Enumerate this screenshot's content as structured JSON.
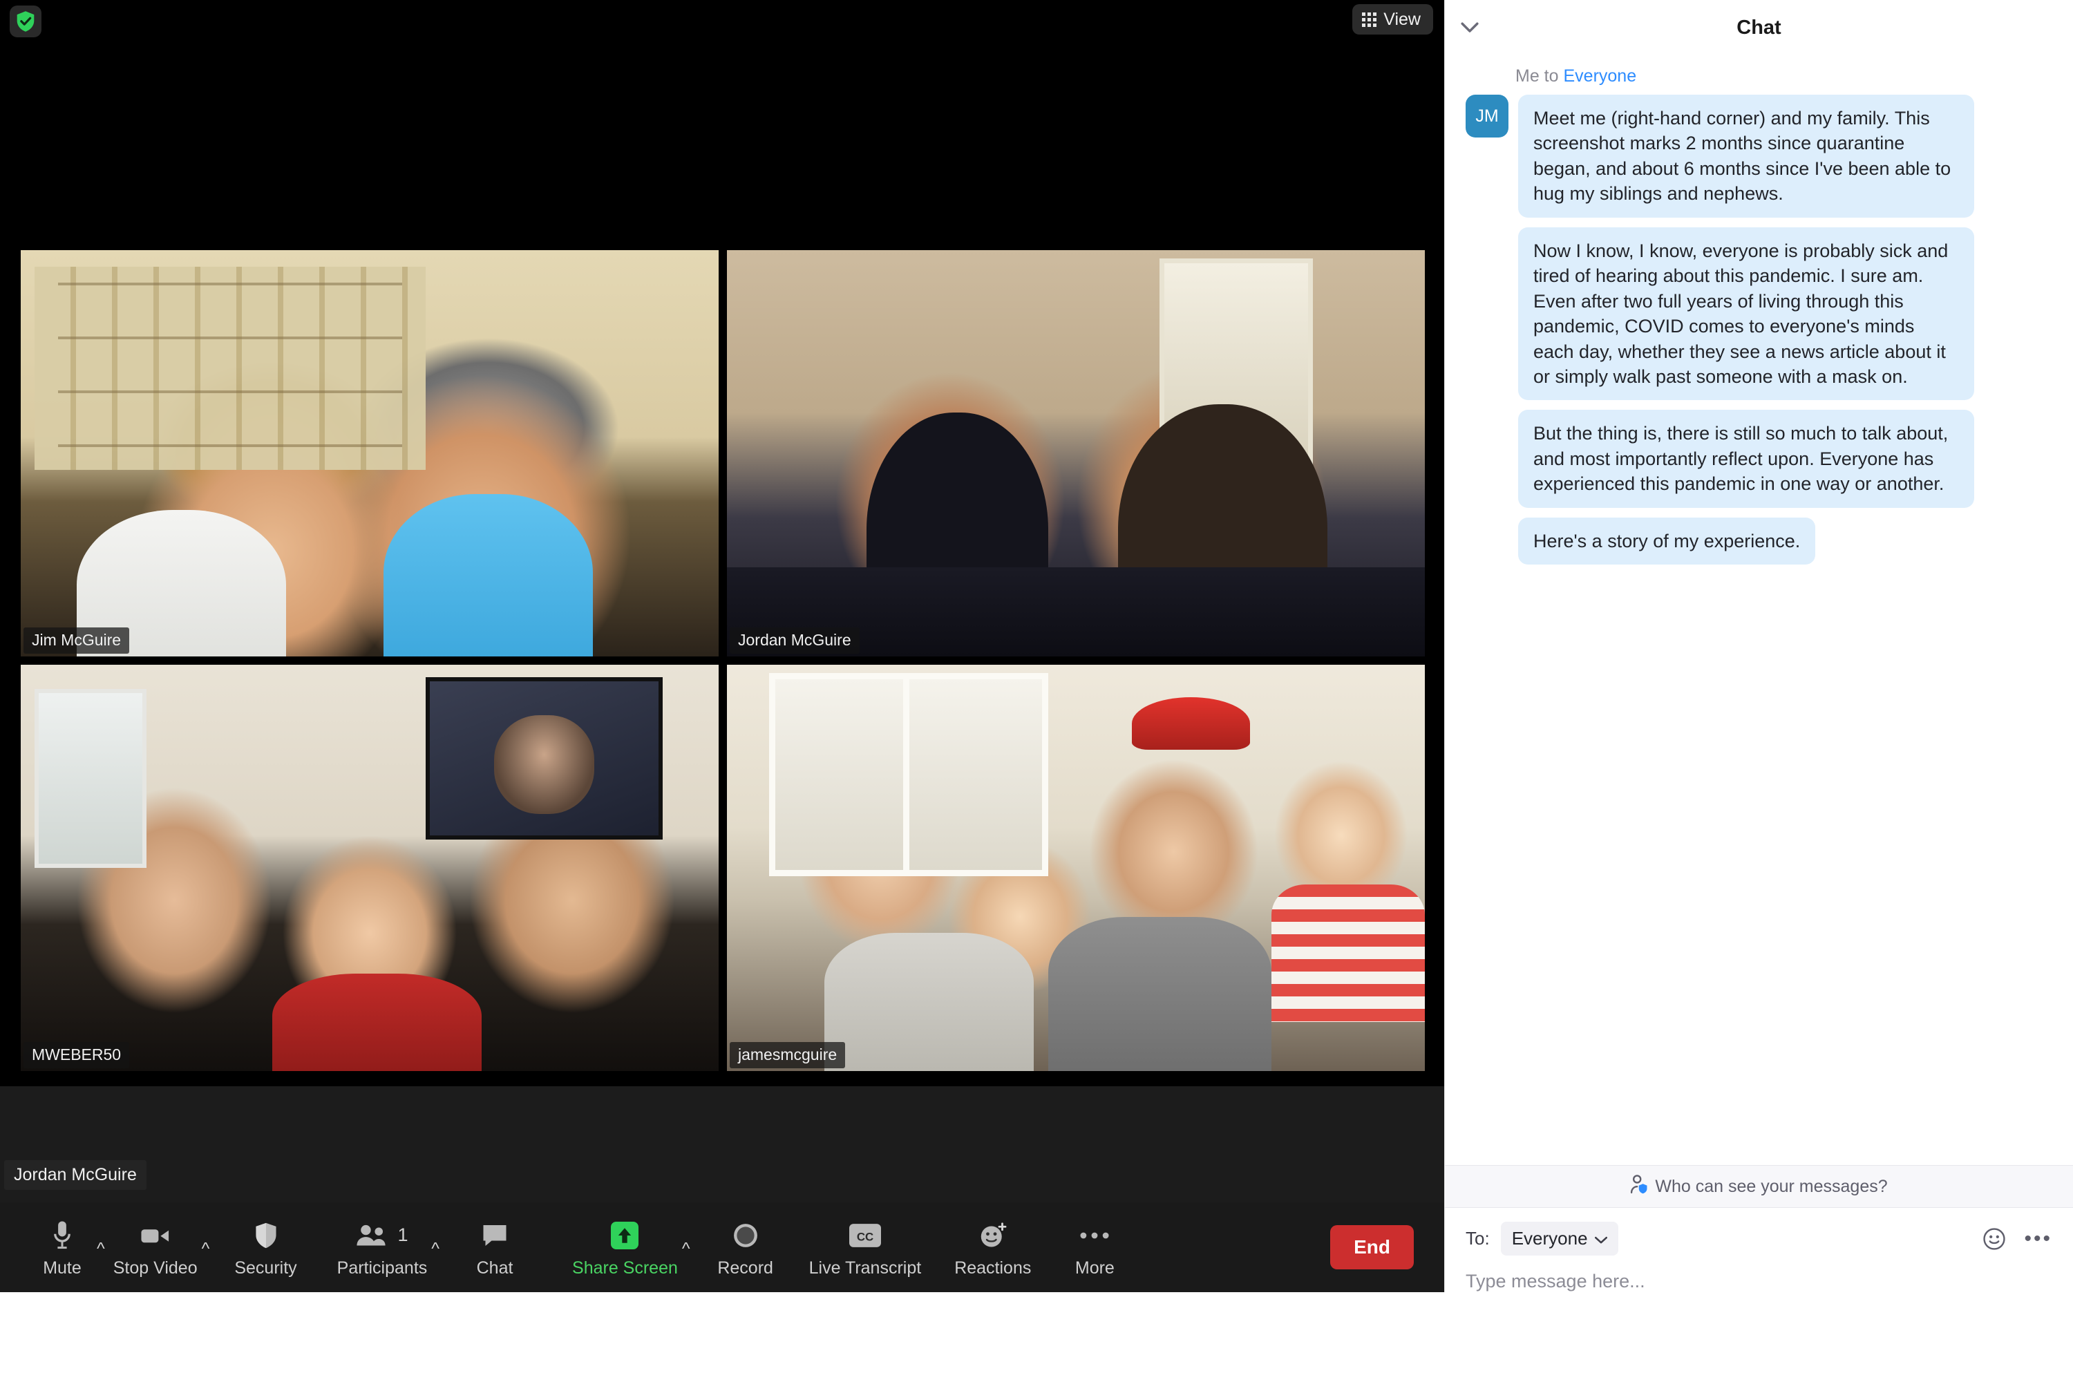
{
  "meeting": {
    "encryption_icon": "shield-check-icon",
    "view_button": {
      "label": "View",
      "icon": "grid-icon"
    },
    "self_name_label": "Jordan McGuire",
    "active_speaker_border_color": "#f2f36b",
    "participants": [
      {
        "name": "Jim McGuire",
        "active": false
      },
      {
        "name": "Jordan McGuire",
        "active": false
      },
      {
        "name": "MWEBER50",
        "active": false
      },
      {
        "name": "jamesmcguire",
        "active": true
      }
    ]
  },
  "toolbar": {
    "items": [
      {
        "label": "Mute",
        "icon": "microphone-icon",
        "caret": true,
        "accent": false
      },
      {
        "label": "Stop Video",
        "icon": "video-camera-icon",
        "caret": true,
        "accent": false
      },
      {
        "label": "Security",
        "icon": "shield-icon",
        "caret": false,
        "accent": false
      },
      {
        "label": "Participants",
        "icon": "people-icon",
        "caret": true,
        "accent": false,
        "badge": "1"
      },
      {
        "label": "Chat",
        "icon": "speech-bubble-icon",
        "caret": false,
        "accent": false
      },
      {
        "label": "Share Screen",
        "icon": "share-arrow-icon",
        "caret": true,
        "accent": true
      },
      {
        "label": "Record",
        "icon": "record-circle-icon",
        "caret": false,
        "accent": false
      },
      {
        "label": "Live Transcript",
        "icon": "cc-icon",
        "caret": false,
        "accent": false
      },
      {
        "label": "Reactions",
        "icon": "smiley-plus-icon",
        "caret": false,
        "accent": false
      },
      {
        "label": "More",
        "icon": "ellipsis-icon",
        "caret": false,
        "accent": false
      }
    ],
    "end_label": "End",
    "end_color": "#cc2e2e",
    "accent_color": "#4ad463"
  },
  "chat": {
    "title": "Chat",
    "collapse_icon": "chevron-down-icon",
    "from_prefix": "Me to ",
    "from_target": "Everyone",
    "avatar_initials": "JM",
    "avatar_color": "#2d8cc0",
    "link_color": "#2d8cff",
    "bubble_color": "#ddeefc",
    "messages": [
      "Meet me (right-hand corner) and my family. This screenshot marks 2 months since quarantine began, and about 6 months since I've been able to hug my siblings and nephews.",
      "Now I know, I know, everyone is probably sick and tired of hearing about this pandemic. I sure am. Even after two full years of living through this pandemic, COVID comes to everyone's minds each day, whether they see a news article about it or simply walk past someone with a mask on.",
      "But the thing is, there is still so much to talk about, and most importantly reflect upon. Everyone has experienced this pandemic in one way or another.",
      "Here's a story of my experience."
    ],
    "privacy_notice": "Who can see your messages?",
    "privacy_icon": "person-shield-icon",
    "to_label": "To:",
    "to_value": "Everyone",
    "to_caret_icon": "chevron-down-icon",
    "emoji_icon": "smiley-icon",
    "more_icon": "ellipsis-icon",
    "input_placeholder": "Type message here..."
  }
}
